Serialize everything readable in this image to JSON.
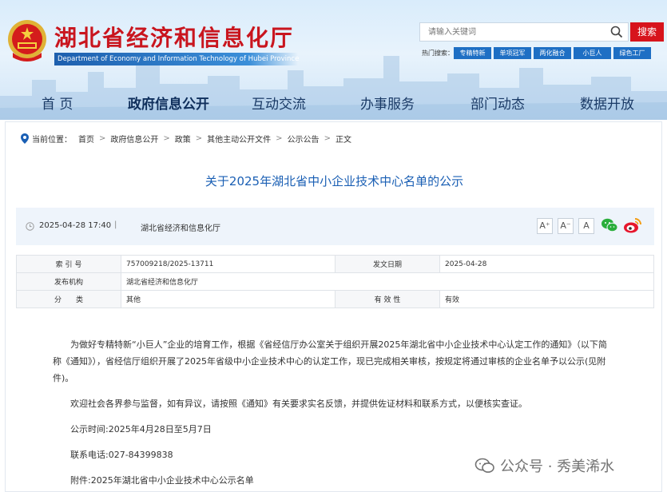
{
  "header": {
    "title": "湖北省经济和信息化厅",
    "subtitle": "Department of Economy and Information Technology of Hubei Province",
    "search_placeholder": "请输入关键词",
    "search_button": "搜索",
    "hot_label": "热门搜索：",
    "hot_tags": [
      "专精特新",
      "单项冠军",
      "两化融合",
      "小巨人",
      "绿色工厂"
    ]
  },
  "nav": {
    "items": [
      "首 页",
      "政府信息公开",
      "互动交流",
      "办事服务",
      "部门动态",
      "数据开放"
    ],
    "active_index": 1
  },
  "breadcrumb": {
    "label": "当前位置：",
    "items": [
      "首页",
      "政府信息公开",
      "政策",
      "其他主动公开文件",
      "公示公告",
      "正文"
    ]
  },
  "article": {
    "title": "关于2025年湖北省中小企业技术中心名单的公示",
    "date": "2025-04-28 17:40",
    "separator": "|",
    "source": "湖北省经济和信息化厅",
    "font_sizes": [
      "A⁺",
      "A⁻",
      "A"
    ],
    "share": [
      "wechat-icon",
      "weibo-icon"
    ]
  },
  "info_table": {
    "rows": [
      {
        "label1": "索 引 号",
        "value1": "757009218/2025-13711",
        "label2": "发文日期",
        "value2": "2025-04-28"
      },
      {
        "label1": "发布机构",
        "value1": "湖北省经济和信息化厅",
        "label2": "",
        "value2": ""
      },
      {
        "label1": "分　　类",
        "value1": "其他",
        "label2": "有 效 性",
        "value2": "有效"
      }
    ]
  },
  "body": {
    "para1": "为做好专精特新“小巨人”企业的培育工作，根据《省经信厅办公室关于组织开展2025年湖北省中小企业技术中心认定工作的通知》（以下简称《通知》），省经信厅组织开展了2025年省级中小企业技术中心的认定工作，现已完成相关审核，按规定将通过审核的企业名单予以公示(见附件)。",
    "para2": "欢迎社会各界参与监督，如有异议，请按照《通知》有关要求实名反馈，并提供佐证材料和联系方式，以便核实查证。",
    "period": "公示时间:2025年4月28日至5月7日",
    "phone": "联系电话:027-84399838",
    "attachment": "附件:2025年湖北省中小企业技术中心公示名单"
  },
  "watermark": {
    "text": "公众号 · 秀美浠水"
  },
  "colors": {
    "brand_red": "#c9151e",
    "nav_text": "#1a3a66",
    "title_blue": "#1a5fb4",
    "tag_blue": "#1e6fc4"
  }
}
